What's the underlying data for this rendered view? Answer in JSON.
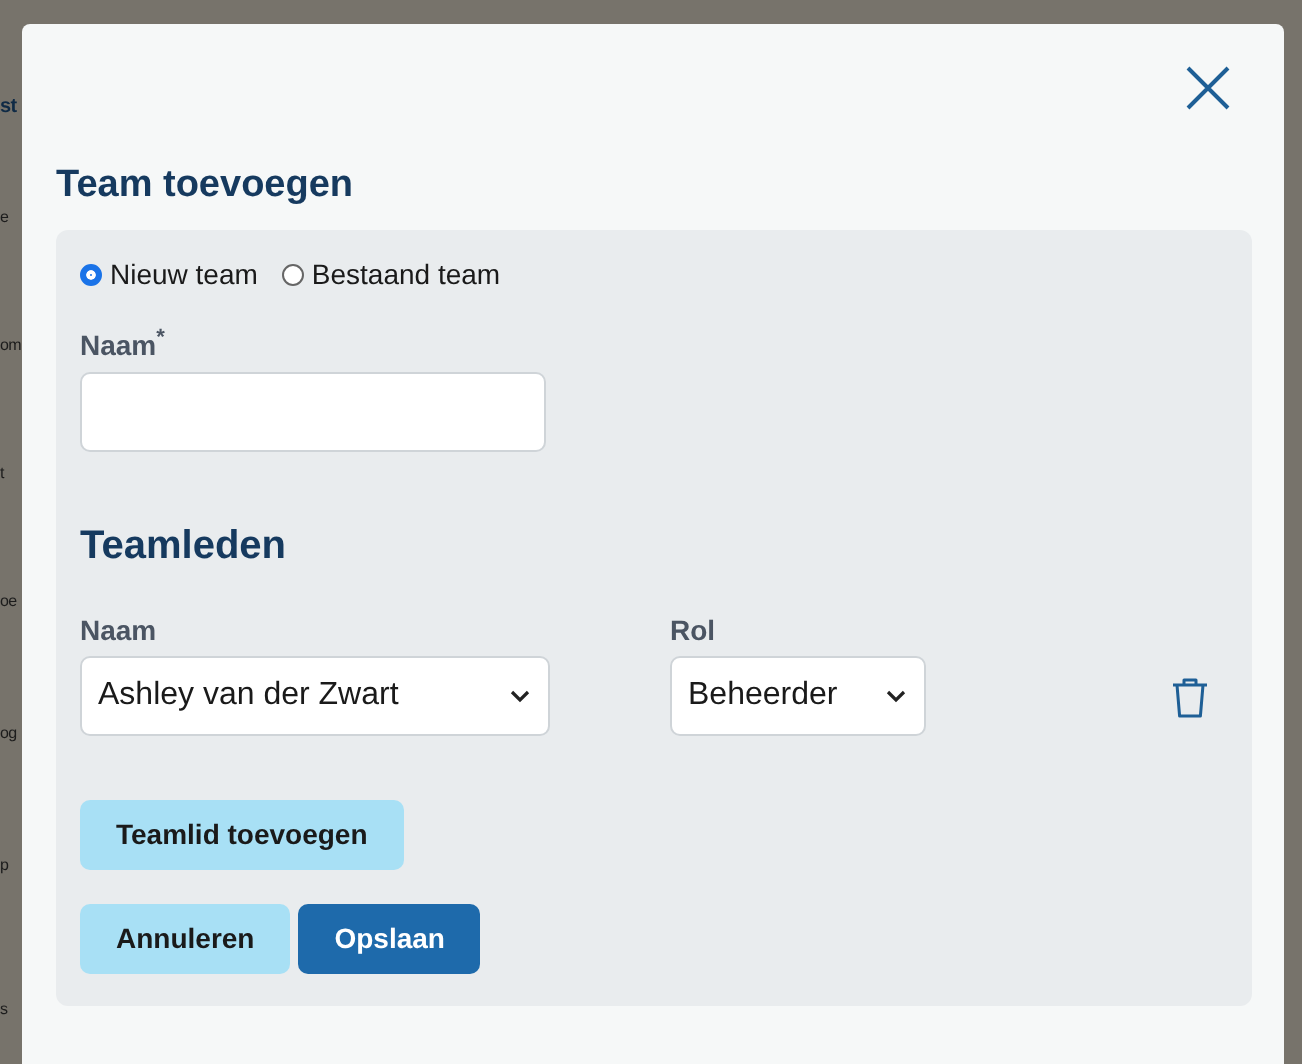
{
  "background_fragments": [
    "st",
    "e",
    "om",
    "t",
    "oe",
    "og",
    "p",
    "s"
  ],
  "dialog": {
    "title": "Team toevoegen",
    "team_type": [
      {
        "label": "Nieuw team",
        "selected": true
      },
      {
        "label": "Bestaand team",
        "selected": false
      }
    ],
    "name_field": {
      "label": "Naam",
      "required_mark": "*"
    },
    "members_heading": "Teamleden",
    "member_columns": [
      "Naam",
      "Rol"
    ],
    "members": [
      {
        "name": "Ashley van der Zwart",
        "role": "Beheerder"
      }
    ],
    "add_member_button": "Teamlid toevoegen",
    "buttons": [
      {
        "label": "Annuleren",
        "kind": "secondary"
      },
      {
        "label": "Opslaan",
        "kind": "primary"
      }
    ]
  }
}
